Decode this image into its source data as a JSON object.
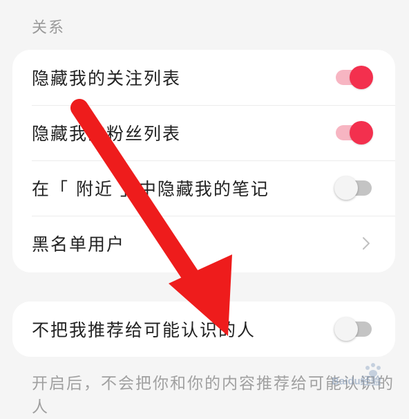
{
  "section": {
    "title": "关系"
  },
  "relations": {
    "items": [
      {
        "label": "隐藏我的关注列表",
        "control": "toggle",
        "state": "on"
      },
      {
        "label": "隐藏我的粉丝列表",
        "control": "toggle",
        "state": "on"
      },
      {
        "label": "在「 附近 」中隐藏我的笔记",
        "control": "toggle",
        "state": "off"
      },
      {
        "label": "黑名单用户",
        "control": "chevron-right-icon"
      }
    ]
  },
  "recommend": {
    "label": "不把我推荐给可能认识的人",
    "control": "toggle",
    "state": "off"
  },
  "footer": {
    "note": "开启后，不会把你和你的内容推荐给可能认识的人"
  },
  "watermark": {
    "text": "Baidu经验"
  },
  "colors": {
    "accent": "#f3304e",
    "accent_track": "#f7b5c2",
    "off_track": "#c4c4c4",
    "annotation_arrow": "#ee1c1c",
    "background": "#f5f5f5"
  }
}
